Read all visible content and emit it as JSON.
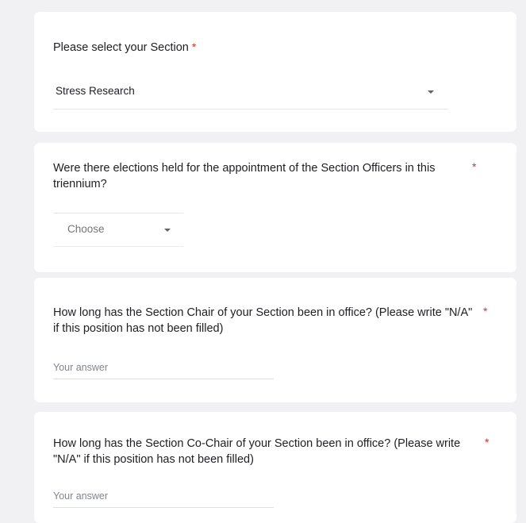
{
  "form": {
    "required_mark": "*",
    "q1": {
      "label": "Please select your Section",
      "selected_value": "Stress Research"
    },
    "q2": {
      "label_line1": "Were there elections held for the appointment of the Section Officers in this",
      "label_line2": "triennium?",
      "selected_value": "Choose"
    },
    "q3": {
      "label_line1": "How long has the Section Chair of your Section been in office? (Please write \"N/A\"",
      "label_line2": "if this position has not been filled)",
      "placeholder": "Your answer"
    },
    "q4": {
      "label_line1": "How long has the Section Co-Chair of your Section been in office? (Please write",
      "label_line2": "\"N/A\" if this position has not been filled)",
      "placeholder": "Your answer"
    }
  },
  "colors": {
    "background": "#f1f1f3",
    "card": "#ffffff",
    "required": "#d93025"
  },
  "icons": {
    "dropdown": "caret-down-icon"
  }
}
